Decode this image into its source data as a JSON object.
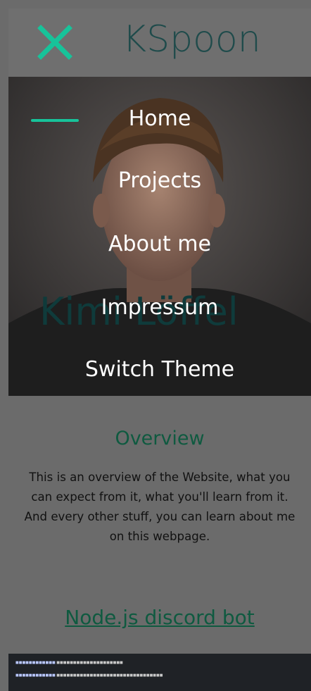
{
  "header": {
    "brand": "KSpoon"
  },
  "hero": {
    "name": "Kimi Löffel"
  },
  "menu": {
    "items": [
      {
        "label": "Home"
      },
      {
        "label": "Projects"
      },
      {
        "label": "About me"
      },
      {
        "label": "Impressum"
      },
      {
        "label": "Switch Theme"
      }
    ]
  },
  "overview": {
    "title": "Overview",
    "text": "This is an overview of the Website, what you can expect from it, what you'll learn from it. And every other stuff, you can learn about me on this webpage."
  },
  "projects": {
    "first_link": "Node.js discord bot"
  },
  "colors": {
    "accent": "#17c39a",
    "brand_text": "#1f4b4b",
    "overlay": "#6b6b6b",
    "link": "#0f5a40"
  }
}
